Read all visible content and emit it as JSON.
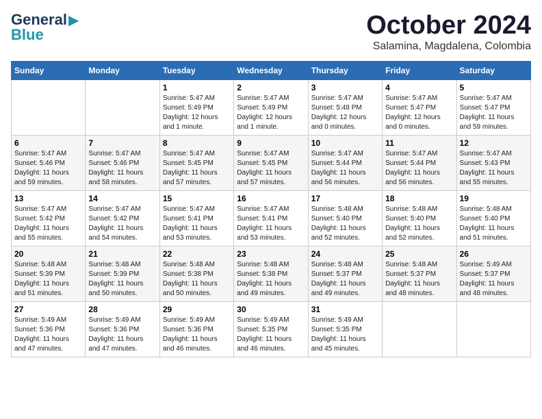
{
  "header": {
    "logo_line1": "General",
    "logo_line2": "Blue",
    "month": "October 2024",
    "location": "Salamina, Magdalena, Colombia"
  },
  "days_of_week": [
    "Sunday",
    "Monday",
    "Tuesday",
    "Wednesday",
    "Thursday",
    "Friday",
    "Saturday"
  ],
  "weeks": [
    [
      {
        "day": "",
        "info": ""
      },
      {
        "day": "",
        "info": ""
      },
      {
        "day": "1",
        "info": "Sunrise: 5:47 AM\nSunset: 5:49 PM\nDaylight: 12 hours\nand 1 minute."
      },
      {
        "day": "2",
        "info": "Sunrise: 5:47 AM\nSunset: 5:49 PM\nDaylight: 12 hours\nand 1 minute."
      },
      {
        "day": "3",
        "info": "Sunrise: 5:47 AM\nSunset: 5:48 PM\nDaylight: 12 hours\nand 0 minutes."
      },
      {
        "day": "4",
        "info": "Sunrise: 5:47 AM\nSunset: 5:47 PM\nDaylight: 12 hours\nand 0 minutes."
      },
      {
        "day": "5",
        "info": "Sunrise: 5:47 AM\nSunset: 5:47 PM\nDaylight: 11 hours\nand 59 minutes."
      }
    ],
    [
      {
        "day": "6",
        "info": "Sunrise: 5:47 AM\nSunset: 5:46 PM\nDaylight: 11 hours\nand 59 minutes."
      },
      {
        "day": "7",
        "info": "Sunrise: 5:47 AM\nSunset: 5:46 PM\nDaylight: 11 hours\nand 58 minutes."
      },
      {
        "day": "8",
        "info": "Sunrise: 5:47 AM\nSunset: 5:45 PM\nDaylight: 11 hours\nand 57 minutes."
      },
      {
        "day": "9",
        "info": "Sunrise: 5:47 AM\nSunset: 5:45 PM\nDaylight: 11 hours\nand 57 minutes."
      },
      {
        "day": "10",
        "info": "Sunrise: 5:47 AM\nSunset: 5:44 PM\nDaylight: 11 hours\nand 56 minutes."
      },
      {
        "day": "11",
        "info": "Sunrise: 5:47 AM\nSunset: 5:44 PM\nDaylight: 11 hours\nand 56 minutes."
      },
      {
        "day": "12",
        "info": "Sunrise: 5:47 AM\nSunset: 5:43 PM\nDaylight: 11 hours\nand 55 minutes."
      }
    ],
    [
      {
        "day": "13",
        "info": "Sunrise: 5:47 AM\nSunset: 5:42 PM\nDaylight: 11 hours\nand 55 minutes."
      },
      {
        "day": "14",
        "info": "Sunrise: 5:47 AM\nSunset: 5:42 PM\nDaylight: 11 hours\nand 54 minutes."
      },
      {
        "day": "15",
        "info": "Sunrise: 5:47 AM\nSunset: 5:41 PM\nDaylight: 11 hours\nand 53 minutes."
      },
      {
        "day": "16",
        "info": "Sunrise: 5:47 AM\nSunset: 5:41 PM\nDaylight: 11 hours\nand 53 minutes."
      },
      {
        "day": "17",
        "info": "Sunrise: 5:48 AM\nSunset: 5:40 PM\nDaylight: 11 hours\nand 52 minutes."
      },
      {
        "day": "18",
        "info": "Sunrise: 5:48 AM\nSunset: 5:40 PM\nDaylight: 11 hours\nand 52 minutes."
      },
      {
        "day": "19",
        "info": "Sunrise: 5:48 AM\nSunset: 5:40 PM\nDaylight: 11 hours\nand 51 minutes."
      }
    ],
    [
      {
        "day": "20",
        "info": "Sunrise: 5:48 AM\nSunset: 5:39 PM\nDaylight: 11 hours\nand 51 minutes."
      },
      {
        "day": "21",
        "info": "Sunrise: 5:48 AM\nSunset: 5:39 PM\nDaylight: 11 hours\nand 50 minutes."
      },
      {
        "day": "22",
        "info": "Sunrise: 5:48 AM\nSunset: 5:38 PM\nDaylight: 11 hours\nand 50 minutes."
      },
      {
        "day": "23",
        "info": "Sunrise: 5:48 AM\nSunset: 5:38 PM\nDaylight: 11 hours\nand 49 minutes."
      },
      {
        "day": "24",
        "info": "Sunrise: 5:48 AM\nSunset: 5:37 PM\nDaylight: 11 hours\nand 49 minutes."
      },
      {
        "day": "25",
        "info": "Sunrise: 5:48 AM\nSunset: 5:37 PM\nDaylight: 11 hours\nand 48 minutes."
      },
      {
        "day": "26",
        "info": "Sunrise: 5:49 AM\nSunset: 5:37 PM\nDaylight: 11 hours\nand 48 minutes."
      }
    ],
    [
      {
        "day": "27",
        "info": "Sunrise: 5:49 AM\nSunset: 5:36 PM\nDaylight: 11 hours\nand 47 minutes."
      },
      {
        "day": "28",
        "info": "Sunrise: 5:49 AM\nSunset: 5:36 PM\nDaylight: 11 hours\nand 47 minutes."
      },
      {
        "day": "29",
        "info": "Sunrise: 5:49 AM\nSunset: 5:36 PM\nDaylight: 11 hours\nand 46 minutes."
      },
      {
        "day": "30",
        "info": "Sunrise: 5:49 AM\nSunset: 5:35 PM\nDaylight: 11 hours\nand 46 minutes."
      },
      {
        "day": "31",
        "info": "Sunrise: 5:49 AM\nSunset: 5:35 PM\nDaylight: 11 hours\nand 45 minutes."
      },
      {
        "day": "",
        "info": ""
      },
      {
        "day": "",
        "info": ""
      }
    ]
  ]
}
